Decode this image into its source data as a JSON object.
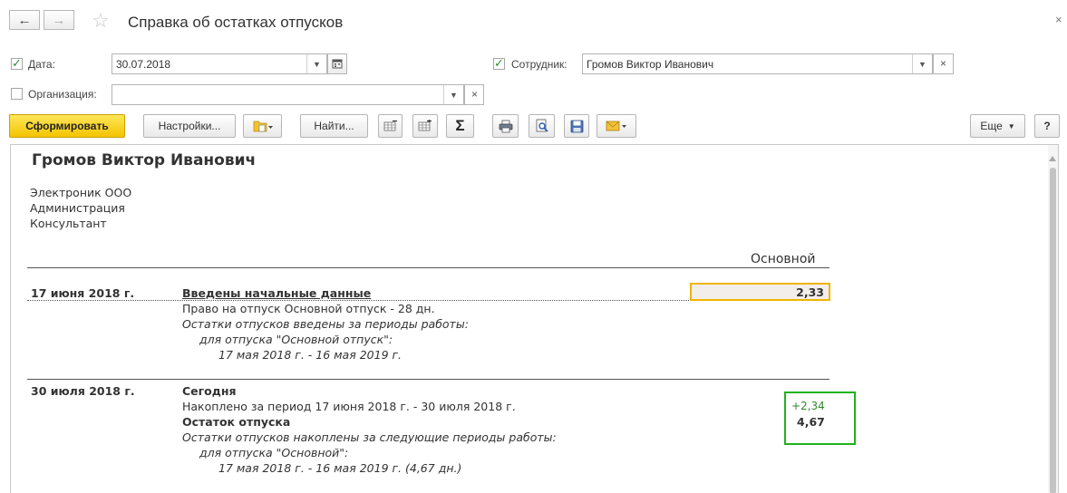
{
  "window": {
    "title": "Справка об остатках отпусков",
    "back_icon": "←",
    "forward_icon": "→",
    "star_icon": "☆",
    "close_icon": "×"
  },
  "filters": {
    "date": {
      "label": "Дата:",
      "checked": true,
      "value": "30.07.2018"
    },
    "employee": {
      "label": "Сотрудник:",
      "checked": true,
      "value": "Громов Виктор Иванович"
    },
    "organization": {
      "label": "Организация:",
      "checked": false,
      "value": ""
    }
  },
  "toolbar": {
    "generate_label": "Сформировать",
    "settings_label": "Настройки...",
    "find_label": "Найти...",
    "more_label": "Еще",
    "help_label": "?",
    "sum_icon": "Σ"
  },
  "report": {
    "employee_name": "Громов Виктор Иванович",
    "org": "Электроник ООО",
    "department": "Администрация",
    "position": "Консультант",
    "column_header": "Основной",
    "entry1": {
      "date": "17 июня 2018 г.",
      "title": "Введены начальные данные",
      "value": "2,33",
      "line1": "Право на отпуск Основной отпуск - 28 дн.",
      "line2": "Остатки отпусков введены за периоды работы:",
      "line3": "для отпуска \"Основной отпуск\":",
      "line4": "17 мая 2018 г. - 16 мая 2019 г."
    },
    "entry2": {
      "date": "30 июля 2018 г.",
      "title": "Сегодня",
      "accrued_delta": "+2,34",
      "balance": "4,67",
      "line1": "Накоплено за период 17 июня 2018 г. - 30 июля 2018 г.",
      "line2": "Остаток отпуска",
      "line3": "Остатки отпусков накоплены за следующие периоды работы:",
      "line4": "для отпуска \"Основной\":",
      "line5": "17 мая 2018 г. - 16 мая 2019 г. (4,67 дн.)"
    }
  },
  "colors": {
    "primary_button": "#f3c400",
    "selected_cell_border": "#f0b400",
    "highlight_box": "#21b21c",
    "delta_text": "#2e8b2e"
  }
}
